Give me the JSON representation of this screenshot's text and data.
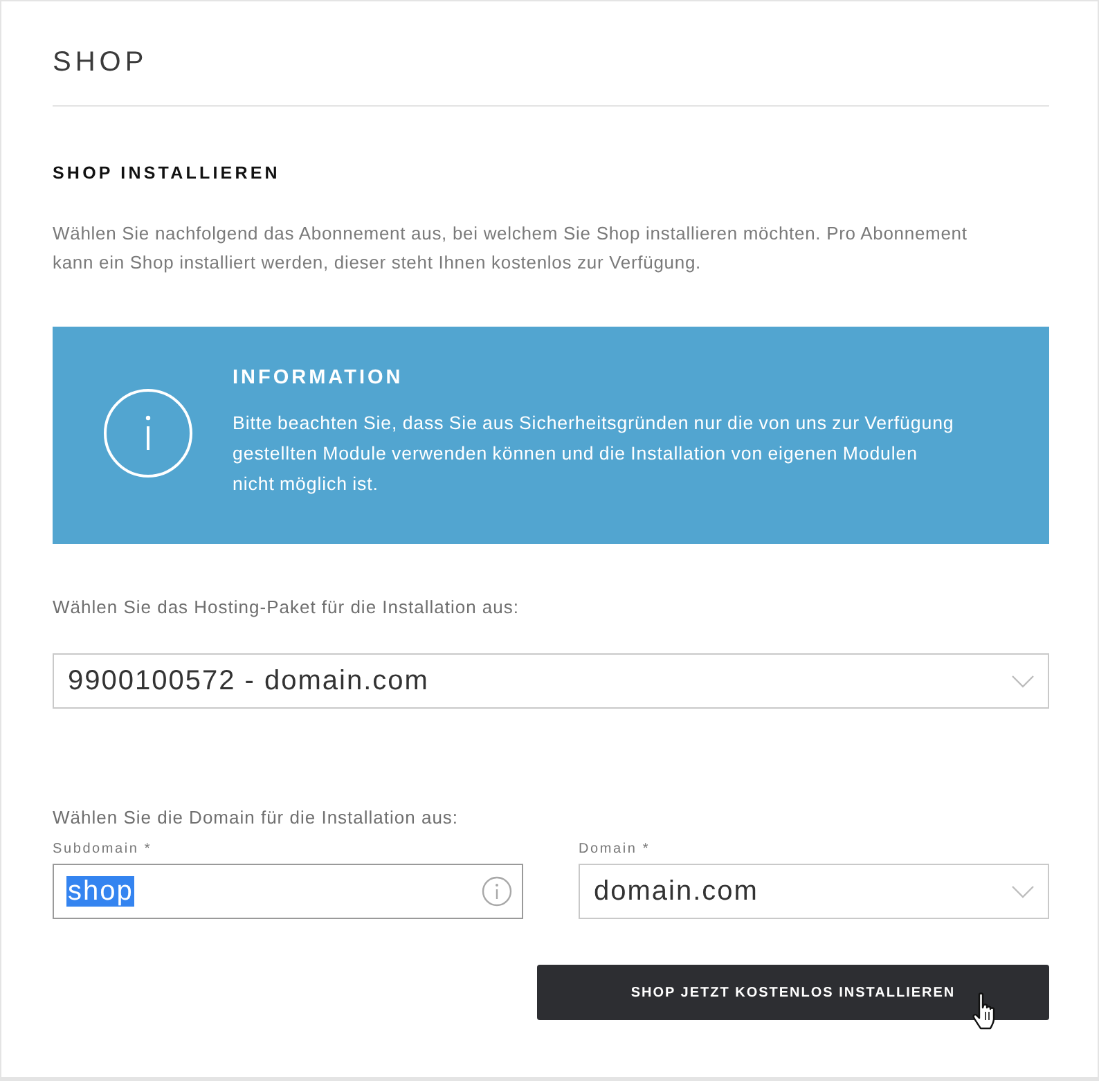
{
  "page": {
    "title": "SHOP"
  },
  "section": {
    "heading": "SHOP INSTALLIEREN",
    "intro": "Wählen Sie nachfolgend das Abonnement aus, bei welchem Sie Shop installieren möchten. Pro Abonnement kann ein Shop installiert werden, dieser steht Ihnen kostenlos zur Verfügung."
  },
  "info_box": {
    "title": "INFORMATION",
    "text": "Bitte beachten Sie, dass Sie aus Sicherheitsgründen nur die von uns zur Verfügung gestellten Module verwenden können und die Installation von eigenen Modulen nicht möglich ist."
  },
  "hosting": {
    "label": "Wählen Sie das Hosting-Paket für die Installation aus:",
    "value": "9900100572 - domain.com"
  },
  "domain_section": {
    "label": "Wählen Sie die Domain für die Installation aus:",
    "fields": [
      {
        "kind": "text",
        "label": "Subdomain *",
        "value": "shop",
        "highlighted": true
      },
      {
        "kind": "select",
        "label": "Domain *",
        "value": "domain.com"
      }
    ]
  },
  "install_button": {
    "label": "SHOP JETZT KOSTENLOS INSTALLIEREN"
  }
}
